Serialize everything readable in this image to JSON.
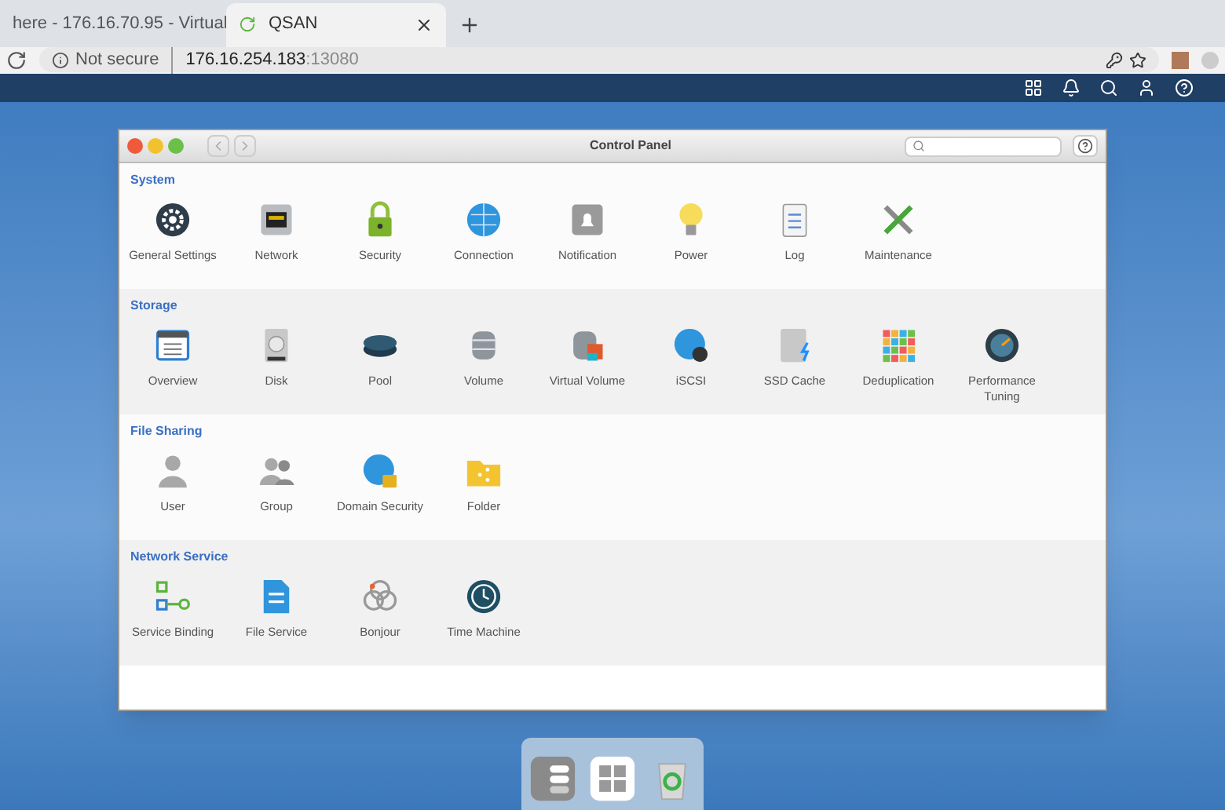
{
  "browser": {
    "tabs": [
      {
        "label": "here - 176.16.70.95 - Virtual",
        "selected": false
      },
      {
        "label": "QSAN",
        "selected": true
      }
    ],
    "security": "Not secure",
    "host": "176.16.254.183",
    "port": ":13080"
  },
  "window": {
    "title": "Control Panel"
  },
  "sections": [
    {
      "title": "System",
      "items": [
        {
          "label": "General Settings",
          "kind": "gear"
        },
        {
          "label": "Network",
          "kind": "port"
        },
        {
          "label": "Security",
          "kind": "padlock"
        },
        {
          "label": "Connection",
          "kind": "globe"
        },
        {
          "label": "Notification",
          "kind": "bell"
        },
        {
          "label": "Power",
          "kind": "bulb"
        },
        {
          "label": "Log",
          "kind": "notepad"
        },
        {
          "label": "Maintenance",
          "kind": "tools"
        }
      ]
    },
    {
      "title": "Storage",
      "items": [
        {
          "label": "Overview",
          "kind": "window"
        },
        {
          "label": "Disk",
          "kind": "drive"
        },
        {
          "label": "Pool",
          "kind": "puck"
        },
        {
          "label": "Volume",
          "kind": "database"
        },
        {
          "label": "Virtual Volume",
          "kind": "dbstack"
        },
        {
          "label": "iSCSI",
          "kind": "globebadge"
        },
        {
          "label": "SSD Cache",
          "kind": "ssd"
        },
        {
          "label": "Deduplication",
          "kind": "grid"
        },
        {
          "label": "Performance Tuning",
          "kind": "gauge"
        }
      ]
    },
    {
      "title": "File Sharing",
      "items": [
        {
          "label": "User",
          "kind": "person"
        },
        {
          "label": "Group",
          "kind": "people"
        },
        {
          "label": "Domain Security",
          "kind": "globelock"
        },
        {
          "label": "Folder",
          "kind": "folder"
        }
      ]
    },
    {
      "title": "Network Service",
      "items": [
        {
          "label": "Service Binding",
          "kind": "flow"
        },
        {
          "label": "File Service",
          "kind": "document"
        },
        {
          "label": "Bonjour",
          "kind": "rings"
        },
        {
          "label": "Time Machine",
          "kind": "clock"
        }
      ]
    }
  ],
  "dock": [
    {
      "kind": "toggles"
    },
    {
      "kind": "tiles"
    },
    {
      "kind": "bin"
    }
  ]
}
